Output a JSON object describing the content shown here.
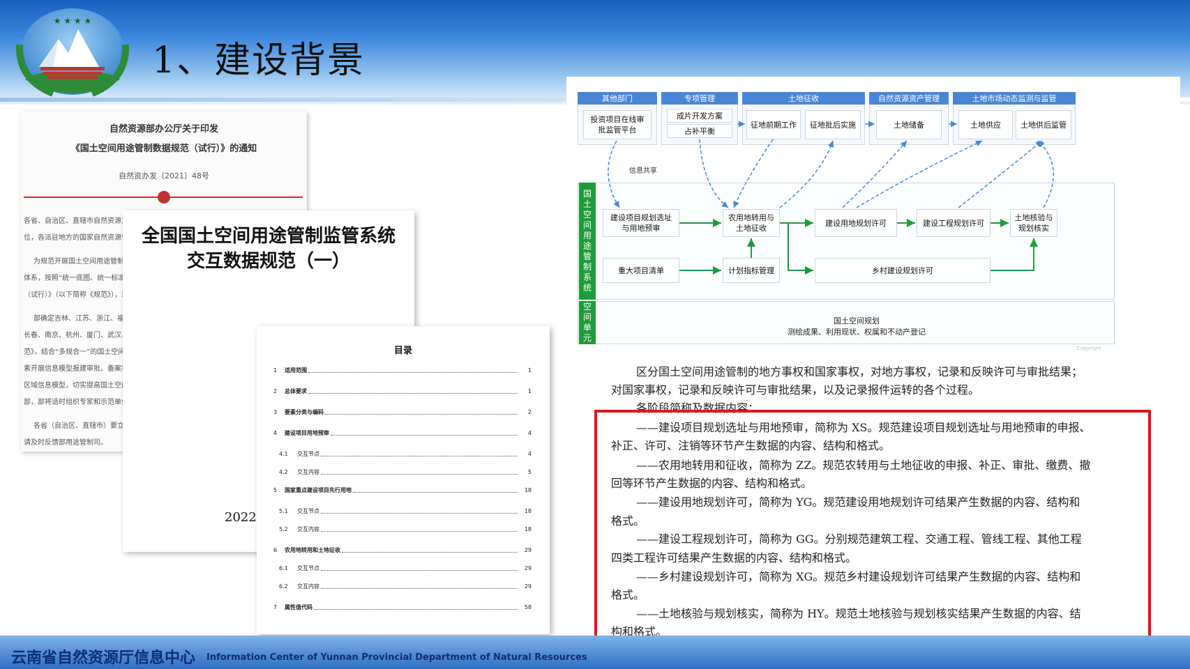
{
  "slide": {
    "title": "1、建设背景"
  },
  "footer": {
    "org_cn": "云南省自然资源厅信息中心",
    "org_en": "Information Center  of Yunnan Provincial Department of Natural Resources"
  },
  "doc_notice": {
    "title_line1": "自然资源部办公厅关于印发",
    "title_line2": "《国土空间用途管制数据规范（试行）》的通知",
    "doc_number": "自然资办发〔2021〕48号",
    "paragraphs": [
      "各省、自治区、直辖市自然资源主管部",
      "位，各派驻地方的国家自然资源督察局",
      "为规范开展国土空间用途管制信息",
      "体系，按照“统一底图、统一标准、统一",
      "（试行）》（以下简称《规范》），现",
      "部确定吉林、江苏、浙江、福建、",
      "长春、南京、杭州、厦门、武汉、长沙",
      "范》，结合“多规合一”的国土空间规划",
      "素开展信息模型报建审批、备案和动态",
      "区域信息模型，切实提高国土空间治理",
      "部，部将适时组织专家和示范单位进行",
      "各省（自治区、直辖市）要立足本",
      "请及时反馈部用途管制司。"
    ]
  },
  "doc_spec": {
    "title_line1": "全国国土空间用途管制监管系统",
    "title_line2": "交互数据规范（一）",
    "year": "2022"
  },
  "doc_toc": {
    "title": "目录",
    "rows": [
      {
        "num": "1",
        "label": "适用范围",
        "page": "1",
        "level": "main"
      },
      {
        "num": "2",
        "label": "总体要求",
        "page": "1",
        "level": "main"
      },
      {
        "num": "3",
        "label": "要素分类与编码",
        "page": "2",
        "level": "main"
      },
      {
        "num": "4",
        "label": "建设项目用地预审",
        "page": "4",
        "level": "main"
      },
      {
        "num": "4.1",
        "label": "交互节点",
        "page": "4",
        "level": "sub"
      },
      {
        "num": "4.2",
        "label": "交互内容",
        "page": "5",
        "level": "sub"
      },
      {
        "num": "5",
        "label": "国家重点建设项目先行用地",
        "page": "18",
        "level": "main"
      },
      {
        "num": "5.1",
        "label": "交互节点",
        "page": "18",
        "level": "sub"
      },
      {
        "num": "5.2",
        "label": "交互内容",
        "page": "18",
        "level": "sub"
      },
      {
        "num": "6",
        "label": "农用地转用和土地征收",
        "page": "29",
        "level": "main"
      },
      {
        "num": "6.1",
        "label": "交互节点",
        "page": "29",
        "level": "sub"
      },
      {
        "num": "6.2",
        "label": "交互内容",
        "page": "29",
        "level": "sub"
      },
      {
        "num": "7",
        "label": "属性值代码",
        "page": "58",
        "level": "main"
      }
    ]
  },
  "flowchart": {
    "headers": [
      "其他部门",
      "专项管理",
      "土地征收",
      "自然资源资产管理",
      "土地市场动态监测与监管"
    ],
    "top_boxes": [
      "投资项目在线审\n批监管平台",
      "成片开发方案",
      "占补平衡",
      "征地前期工作",
      "征地批后实施",
      "土地储备",
      "土地供应",
      "土地供后监管"
    ],
    "info_share": "信息共享",
    "system_label": "国土空间用途管制系统",
    "unit_label": "空间单元",
    "middle_boxes": [
      "建设项目规划选址\n与用地预审",
      "农用地转用与\n土地征收",
      "建设用地规划许可",
      "建设工程规划许可",
      "土地核验与\n规划核实",
      "重大项目清单",
      "计划指标管理",
      "乡村建设规划许可"
    ],
    "base_line1": "国土空间规划",
    "base_line2": "测绘成果、利用现状、权属和不动产登记",
    "watermark": "Copyright"
  },
  "description": {
    "intro_line1": "区分国土空间用途管制的地方事权和国家事权，对地方事权，记录和反映许可与审批结果；",
    "intro_line2": "对国家事权，记录和反映许可与审批结果，以及记录报件运转的各个过程。",
    "intro_line3": "各阶段简称及数据内容：",
    "items": [
      {
        "line1": "——建设项目规划选址与用地预审，简称为 XS。规范建设项目规划选址与用地预审的申报、",
        "line2": "补正、许可、注销等环节产生数据的内容、结构和格式。"
      },
      {
        "line1": "——农用地转用和征收，简称为 ZZ。规范农转用与土地征收的申报、补正、审批、缴费、撤",
        "line2": "回等环节产生数据的内容、结构和格式。"
      },
      {
        "line1": "——建设用地规划许可，简称为 YG。规范建设用地规划许可结果产生数据的内容、结构和",
        "line2": "格式。"
      },
      {
        "line1": "——建设工程规划许可，简称为 GG。分别规范建筑工程、交通工程、管线工程、其他工程",
        "line2": "四类工程许可结果产生数据的内容、结构和格式。"
      },
      {
        "line1": "——乡村建设规划许可，简称为 XG。规范乡村建设规划许可结果产生数据的内容、结构和",
        "line2": "格式。"
      },
      {
        "line1": "——土地核验与规划核实，简称为 HY。规范土地核验与规划核实结果产生数据的内容、结",
        "line2": "构和格式。"
      }
    ]
  },
  "colors": {
    "highlight_border": "#e0141e",
    "flow_header": "#4a86d8",
    "system_bar": "#1f9b3a",
    "band": "#1a5fc0"
  }
}
